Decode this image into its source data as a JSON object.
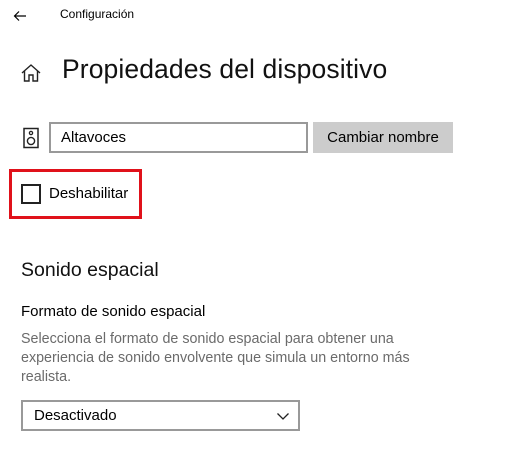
{
  "header": {
    "app_title": "Configuración",
    "back_icon": "arrow-left-icon"
  },
  "page": {
    "title": "Propiedades del dispositivo",
    "home_icon": "home-icon"
  },
  "device": {
    "icon": "speaker-icon",
    "name_value": "Altavoces",
    "rename_label": "Cambiar nombre"
  },
  "disable": {
    "label": "Deshabilitar",
    "checked": false,
    "highlight_color": "#e0111a"
  },
  "spatial_sound": {
    "section_title": "Sonido espacial",
    "format_label": "Formato de sonido espacial",
    "description": "Selecciona el formato de sonido espacial para obtener una experiencia de sonido envolvente que simula un entorno más realista.",
    "selected": "Desactivado",
    "dropdown_icon": "chevron-down-icon"
  }
}
